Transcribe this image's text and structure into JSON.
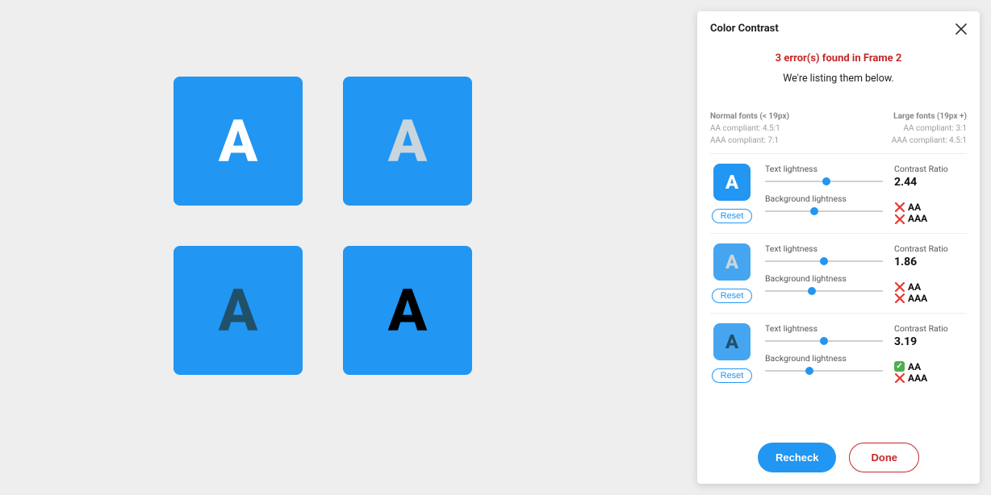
{
  "canvas": {
    "glyph": "A",
    "bg": "#2196f3",
    "tiles": [
      {
        "text_color": "#ffffff"
      },
      {
        "text_color": "#c9d6de"
      },
      {
        "text_color": "#21506b"
      },
      {
        "text_color": "#000000"
      }
    ]
  },
  "panel": {
    "title": "Color Contrast",
    "error_summary": "3 error(s) found in Frame 2",
    "listing_text": "We're listing them below.",
    "compliance": {
      "normal": {
        "heading": "Normal fonts (< 19px)",
        "aa": "AA compliant: 4.5:1",
        "aaa": "AAA compliant: 7:1"
      },
      "large": {
        "heading": "Large fonts (19px +)",
        "aa": "AA compliant: 3:1",
        "aaa": "AAA compliant: 4.5:1"
      }
    },
    "slider_labels": {
      "text": "Text lightness",
      "bg": "Background lightness"
    },
    "ratio_label": "Contrast Ratio",
    "aa_label": "AA",
    "aaa_label": "AAA",
    "reset_label": "Reset",
    "items": [
      {
        "preview_bg": "#2196f3",
        "preview_text_color": "#ffffff",
        "glyph": "A",
        "text_slider": 52,
        "bg_slider": 42,
        "ratio": "2.44",
        "aa_pass": false,
        "aaa_pass": false
      },
      {
        "preview_bg": "#46a5f0",
        "preview_text_color": "#c9d6de",
        "glyph": "A",
        "text_slider": 50,
        "bg_slider": 40,
        "ratio": "1.86",
        "aa_pass": false,
        "aaa_pass": false
      },
      {
        "preview_bg": "#46a5f0",
        "preview_text_color": "#21506b",
        "glyph": "A",
        "text_slider": 50,
        "bg_slider": 38,
        "ratio": "3.19",
        "aa_pass": true,
        "aaa_pass": false
      }
    ],
    "footer": {
      "recheck": "Recheck",
      "done": "Done"
    }
  }
}
